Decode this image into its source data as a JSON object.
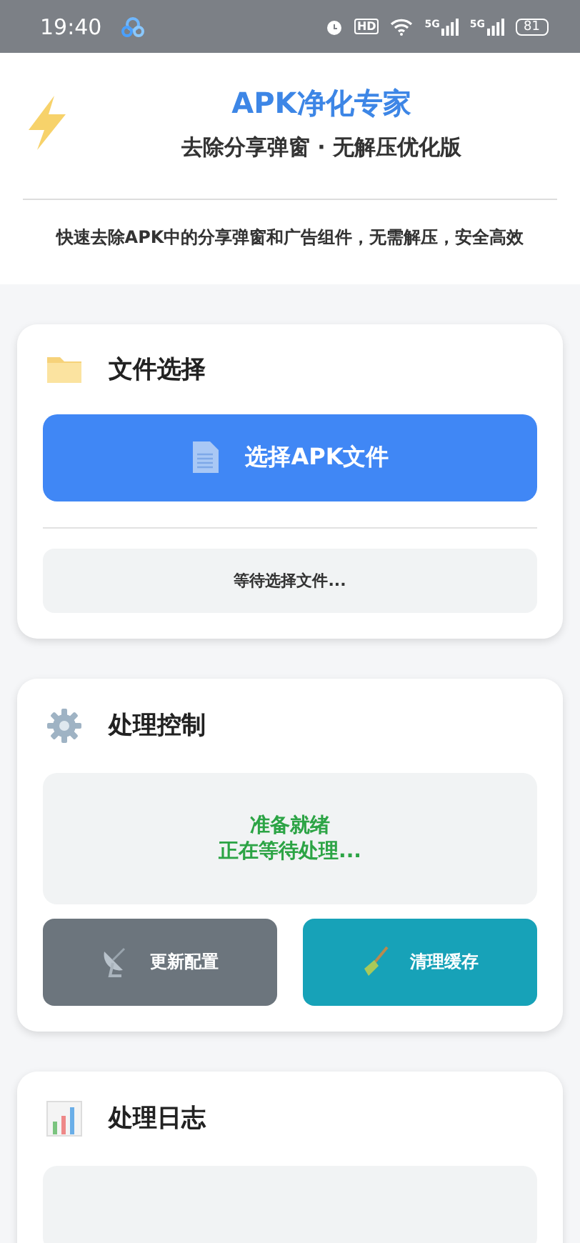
{
  "status_bar": {
    "time": "19:40",
    "hd_label": "HD",
    "signal_labels": [
      "5G",
      "5G"
    ],
    "battery": "81"
  },
  "header": {
    "title": "APK净化专家",
    "subtitle": "去除分享弹窗 · 无解压优化版",
    "description": "快速去除APK中的分享弹窗和广告组件，无需解压，安全高效"
  },
  "file_card": {
    "title": "文件选择",
    "select_button": "选择APK文件",
    "file_status": "等待选择文件..."
  },
  "control_card": {
    "title": "处理控制",
    "status_lines": [
      "准备就绪",
      "正在等待处理..."
    ],
    "buttons": [
      {
        "kind": "update",
        "label": "更新配置"
      },
      {
        "kind": "clean",
        "label": "清理缓存"
      }
    ]
  },
  "log_card": {
    "title": "处理日志"
  }
}
